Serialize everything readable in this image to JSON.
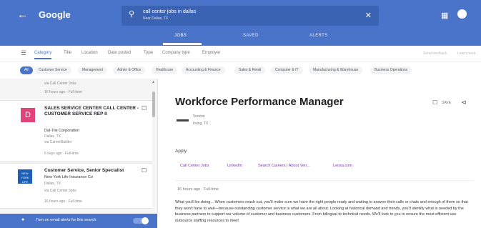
{
  "appbar": {
    "back_icon": "arrow-left-icon",
    "logo": "Google",
    "search_query": "call center jobs in dallas",
    "search_location": "Near Dallas, TX",
    "search_icon": "search-icon",
    "clear_icon": "close-icon",
    "apps_icon": "apps-grid-icon",
    "account_icon": "account-icon"
  },
  "tabs": [
    {
      "label": "JOBS",
      "active": true
    },
    {
      "label": "SAVED",
      "active": false
    },
    {
      "label": "ALERTS",
      "active": false
    }
  ],
  "filters": {
    "icon": "filter-list-icon",
    "items": [
      {
        "label": "Category",
        "active": true
      },
      {
        "label": "Title"
      },
      {
        "label": "Location"
      },
      {
        "label": "Date posted"
      },
      {
        "label": "Type"
      },
      {
        "label": "Company type"
      },
      {
        "label": "Employer"
      }
    ],
    "right_items": [
      "Send feedback",
      "Learn more"
    ]
  },
  "chips": [
    {
      "label": "All",
      "active": true
    },
    {
      "label": "Customer Service"
    },
    {
      "label": "Management"
    },
    {
      "label": "Admin & Office"
    },
    {
      "label": "Healthcare"
    },
    {
      "label": "Accounting & Finance"
    },
    {
      "label": "Sales & Retail"
    },
    {
      "label": "Computer & IT"
    },
    {
      "label": "Manufacturing & Warehouse"
    },
    {
      "label": "Business Operations"
    }
  ],
  "list": {
    "prev_via": "via Call Center Jobs",
    "prev_meta": "16 hours ago · Full-time",
    "jobs": [
      {
        "logo_letter": "D",
        "title": "SALES SERVICE CENTER CALL CENTER - CUSTOMER SERVICE REP II",
        "company": "Dal-Tile Corporation",
        "location": "Dallas, TX",
        "via": "via CareerBuilder",
        "meta": "6 days ago · Full-time"
      },
      {
        "logo_text": "NEW YORK LIFE",
        "title": "Customer Service, Senior Specialist",
        "company": "New York Life Insurance Co",
        "location": "Dallas, TX",
        "via": "via Call Center Jobs",
        "meta": "16 hours ago · Full-time"
      }
    ]
  },
  "alert_bar": {
    "icon": "bell-icon",
    "text": "Turn on email alerts for this search",
    "toggle_on": true
  },
  "detail": {
    "title": "Workforce Performance Manager",
    "save_label": "SAVE",
    "save_icon": "bookmark-icon",
    "share_icon": "share-icon",
    "company": "Verizon",
    "location": "Irving, TX",
    "apply_label": "Apply",
    "apply_options": [
      "Call Center Jobs",
      "LinkedIn",
      "Search Careers | About Veri...",
      "Lensa.com"
    ],
    "posted": "16 hours ago · Full-time",
    "description": "What you'll be doing... When customers reach out, you'll make sure we have the right people ready and waiting to answer their calls or chats and enough of them so that they won't have to wait—because outstanding customer service is what we are all about. Looking at historical demand and trends, you'll identify what is needed by the business partners to support our volume of customer and business customers. From bilingual to technical needs. We'll look to you to ensure the most efficient use outsource staffing resources to meet"
  }
}
